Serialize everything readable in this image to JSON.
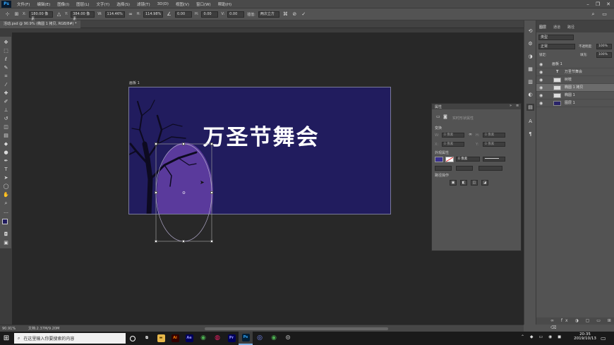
{
  "menu": {
    "logo": "Ps",
    "items": [
      "文件(F)",
      "编辑(E)",
      "图像(I)",
      "图层(L)",
      "文字(Y)",
      "选择(S)",
      "滤镜(T)",
      "3D(D)",
      "视图(V)",
      "窗口(W)",
      "帮助(H)"
    ]
  },
  "options": {
    "x_label": "X:",
    "x_value": "180.00 像素",
    "y_label": "Y:",
    "y_value": "384.00 像素",
    "w_label": "W:",
    "w_value": "114.46%",
    "h_label": "H:",
    "h_value": "114.98%",
    "angle_value": "0.00",
    "hskew_label": "H:",
    "hskew_value": "0.00",
    "vskew_label": "V:",
    "vskew_value": "0.00",
    "interp_label": "插值:",
    "interp_value": "两次立方"
  },
  "document": {
    "tab_title": "活动.psd @ 90.9% (椭圆 1 拷贝, RGB/8#) *",
    "artboard_label": "画板 1",
    "headline": "万圣节舞会",
    "zoom": "90.91%",
    "doc_info": "文档:2.37M/9.20M"
  },
  "colors": {
    "artboard_bg": "#211c5e",
    "moon_purple": "#5a3a9c",
    "tree": "#0d0a20",
    "ps_blue": "#31a8ff"
  },
  "layers_panel": {
    "tabs": [
      "图层",
      "通道",
      "路径"
    ],
    "kind_label": "类型",
    "blend_mode": "正常",
    "opacity_label": "不透明度:",
    "opacity_value": "100%",
    "lock_label": "锁定:",
    "fill_label": "填充:",
    "fill_value": "100%",
    "rows": [
      {
        "name": "画板 1",
        "kind": "group"
      },
      {
        "name": "万圣节舞会",
        "kind": "text"
      },
      {
        "name": "树枝",
        "kind": "image"
      },
      {
        "name": "椭圆 1 拷贝",
        "kind": "shape"
      },
      {
        "name": "椭圆 1",
        "kind": "shape"
      },
      {
        "name": "图层 1",
        "kind": "fill"
      }
    ]
  },
  "properties_panel": {
    "title": "属性",
    "subtitle": "实时形状属性",
    "sec_transform": "变换",
    "w_label": "W:",
    "w_value": "0 像素",
    "h_label": "H:",
    "h_value": "0 像素",
    "x_label": "X:",
    "x_value": "0 像素",
    "y_label": "Y:",
    "y_value": "0 像素",
    "sec_appearance": "外观属性",
    "stroke_width": "0 像素",
    "sec_pathops": "路径操作"
  },
  "taskbar": {
    "search_placeholder": "在这里输入你要搜索的内容",
    "apps": [
      {
        "name": "task-view",
        "label": "⧉",
        "color": "#1a1a1a"
      },
      {
        "name": "explorer",
        "label": "▬",
        "color": "#e8b84a"
      },
      {
        "name": "ai",
        "label": "Ai",
        "color": "#ff7c00"
      },
      {
        "name": "ae",
        "label": "Ae",
        "color": "#9999ff"
      },
      {
        "name": "chrome",
        "label": "◉",
        "color": "#4caf50"
      },
      {
        "name": "media",
        "label": "◍",
        "color": "#e91e63"
      },
      {
        "name": "pr",
        "label": "Pr",
        "color": "#9999ff"
      },
      {
        "name": "ps",
        "label": "Ps",
        "color": "#31a8ff"
      },
      {
        "name": "c4d",
        "label": "◎",
        "color": "#7a8fff"
      },
      {
        "name": "chrome2",
        "label": "◉",
        "color": "#4caf50"
      },
      {
        "name": "camera",
        "label": "⊙",
        "color": "#888888"
      }
    ],
    "time": "20:35",
    "date": "2019/10/13"
  }
}
